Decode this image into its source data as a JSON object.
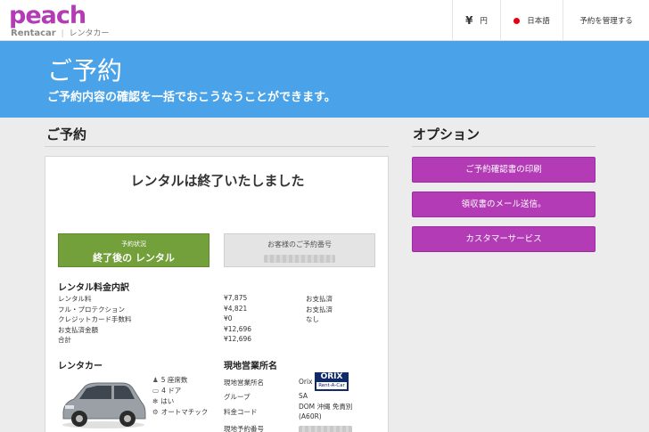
{
  "brand": {
    "logo": "peach",
    "sub_en": "Rentacar",
    "sub_jp": "レンタカー",
    "accent": "#b33bb6"
  },
  "topnav": {
    "currency_symbol": "¥",
    "currency": "円",
    "language": "日本語",
    "manage": "予約を管理する"
  },
  "hero": {
    "title": "ご予約",
    "subtitle": "ご予約内容の確認を一括でおこうなうことができます。",
    "color": "#4aa3e8"
  },
  "reservation": {
    "heading": "ご予約",
    "card_title": "レンタルは終了いたしました",
    "status_label": "予約状況",
    "status_value": "終了後の レンタル",
    "ref_label": "お客様のご予約番号",
    "fee_heading": "レンタル料金内訳",
    "fees": [
      {
        "item": "レンタル料",
        "amount": "¥7,875",
        "status": "お支払済"
      },
      {
        "item": "フル・プロテクション",
        "amount": "¥4,821",
        "status": "お支払済"
      },
      {
        "item": "クレジットカード手数料",
        "amount": "¥0",
        "status": "なし"
      },
      {
        "item": "お支払済金額",
        "amount": "¥12,696",
        "status": ""
      },
      {
        "item": "合計",
        "amount": "¥12,696",
        "status": ""
      }
    ],
    "car_heading": "レンタカー",
    "car_specs": [
      {
        "icon": "person-icon",
        "text": "5 座席数"
      },
      {
        "icon": "door-icon",
        "text": "4 ドア"
      },
      {
        "icon": "aircon-icon",
        "text": "はい"
      },
      {
        "icon": "gear-icon",
        "text": "オートマチック"
      }
    ],
    "store_heading": "現地営業所名",
    "store": {
      "name_label": "現地営業所名",
      "name_value": "Orix",
      "orix_logo_top": "ORIX",
      "orix_logo_bottom": "Rent-A-Car",
      "group_label": "グループ",
      "group_value": "SA",
      "rate_label": "料金コード",
      "rate_value_1": "DOM 沖縄 免責別",
      "rate_value_2": "(A60R)",
      "local_ref_label": "現地予約番号"
    }
  },
  "options": {
    "heading": "オプション",
    "buttons": [
      "ご予約確認書の印刷",
      "領収書のメール送信。",
      "カスタマーサービス"
    ]
  }
}
